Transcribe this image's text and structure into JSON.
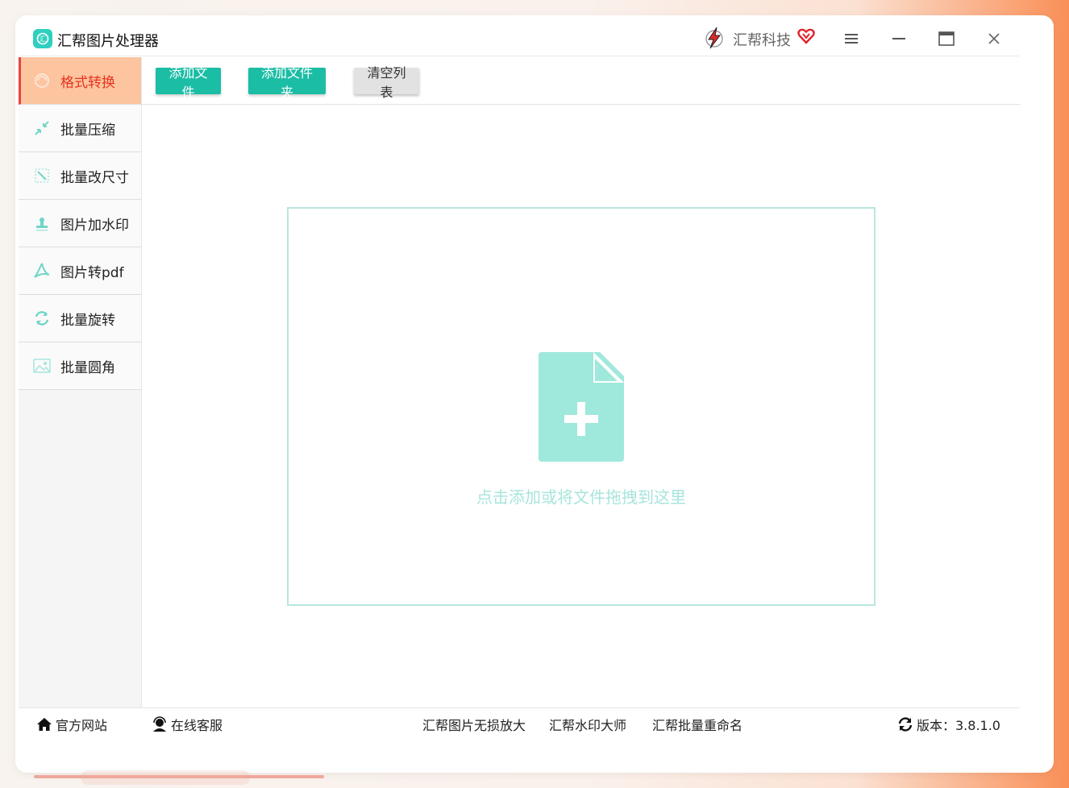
{
  "window": {
    "app_title": "汇帮图片处理器",
    "brand_name": "汇帮科技"
  },
  "sidebar": {
    "items": [
      {
        "label": "格式转换",
        "icon": "format-convert-icon",
        "active": true
      },
      {
        "label": "批量压缩",
        "icon": "compress-icon",
        "active": false
      },
      {
        "label": "批量改尺寸",
        "icon": "resize-icon",
        "active": false
      },
      {
        "label": "图片加水印",
        "icon": "watermark-icon",
        "active": false
      },
      {
        "label": "图片转pdf",
        "icon": "pdf-icon",
        "active": false
      },
      {
        "label": "批量旋转",
        "icon": "rotate-icon",
        "active": false
      },
      {
        "label": "批量圆角",
        "icon": "rounded-corner-icon",
        "active": false
      }
    ]
  },
  "toolbar": {
    "add_file": "添加文件",
    "add_folder": "添加文件夹",
    "clear_list": "清空列表"
  },
  "dropzone": {
    "hint": "点击添加或将文件拖拽到这里"
  },
  "footer": {
    "official_site": "官方网站",
    "online_service": "在线客服",
    "link_enlarge": "汇帮图片无损放大",
    "link_watermark": "汇帮水印大师",
    "link_rename": "汇帮批量重命名",
    "version": "版本：3.8.1.0"
  },
  "colors": {
    "accent": "#1bbda5",
    "active_bg": "#fcc49f",
    "active_text": "#e8331f",
    "dropzone_border": "#b8e6df"
  }
}
